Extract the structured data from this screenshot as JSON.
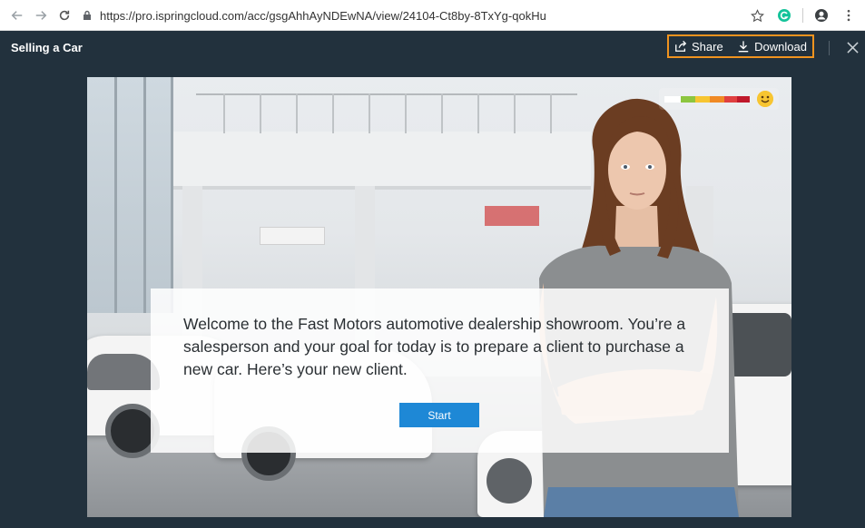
{
  "browser": {
    "url": "https://pro.ispringcloud.com/acc/gsgAhhAyNDEwNA/view/24104-Ct8by-8TxYg-qokHu",
    "icons": [
      "back-arrow-icon",
      "forward-arrow-icon",
      "reload-icon",
      "lock-icon",
      "star-icon",
      "grammarly-icon",
      "account-icon",
      "menu-dots-icon"
    ]
  },
  "header": {
    "title": "Selling a Car",
    "share_label": "Share",
    "download_label": "Download",
    "highlight_color": "#f0931f"
  },
  "slide": {
    "meter": {
      "colors": [
        "#ffffff",
        "#8dc63f",
        "#f7c531",
        "#f08a24",
        "#e04040",
        "#c0192b"
      ],
      "icon": "smiley-icon"
    },
    "dialog": {
      "text": "Welcome to the Fast Motors automotive dealership showroom. You’re a salesperson and your goal for today is to prepare a client to purchase a new car. Here’s your new client.",
      "start_label": "Start",
      "button_color": "#1e88d6"
    }
  }
}
